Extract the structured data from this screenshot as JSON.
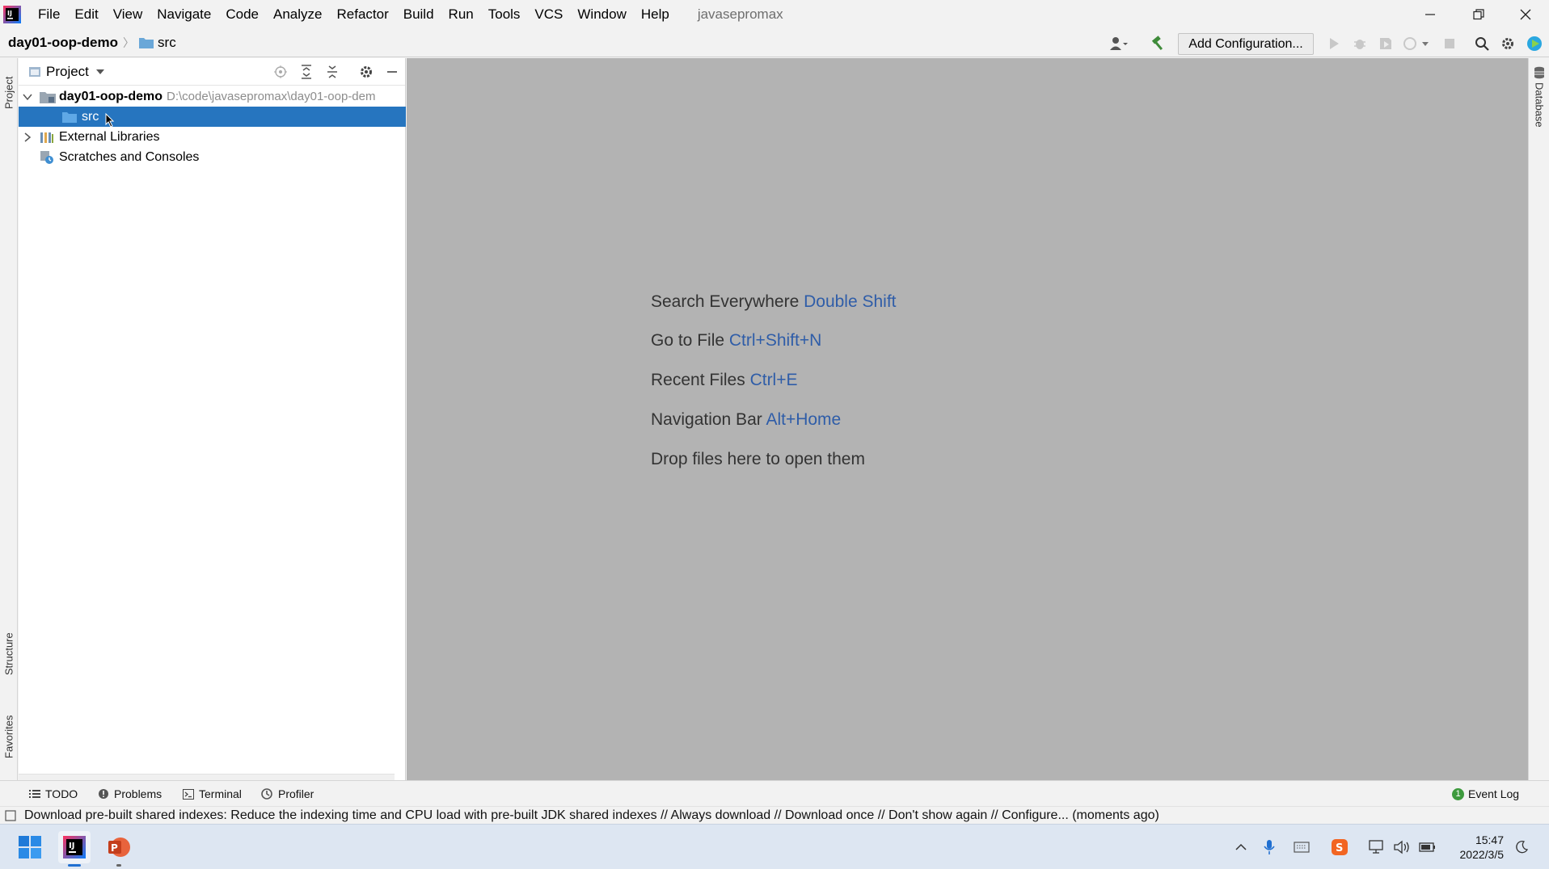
{
  "window": {
    "menu": [
      "File",
      "Edit",
      "View",
      "Navigate",
      "Code",
      "Analyze",
      "Refactor",
      "Build",
      "Run",
      "Tools",
      "VCS",
      "Window",
      "Help"
    ],
    "project_title": "javasepromax"
  },
  "navbar": {
    "crumb_root": "day01-oop-demo",
    "crumb_child": "src",
    "add_config_label": "Add Configuration..."
  },
  "side_tabs": {
    "project": "Project",
    "structure": "Structure",
    "favorites": "Favorites",
    "database": "Database"
  },
  "project_panel": {
    "title": "Project",
    "tree": [
      {
        "label": "day01-oop-demo",
        "path": "D:\\code\\javasepromax\\day01-oop-dem",
        "expanded": true
      },
      {
        "label": "src",
        "selected": true
      },
      {
        "label": "External Libraries",
        "expanded": false
      },
      {
        "label": "Scratches and Consoles"
      }
    ]
  },
  "editor_hints": [
    {
      "text": "Search Everywhere",
      "key": "Double Shift"
    },
    {
      "text": "Go to File",
      "key": "Ctrl+Shift+N"
    },
    {
      "text": "Recent Files",
      "key": "Ctrl+E"
    },
    {
      "text": "Navigation Bar",
      "key": "Alt+Home"
    },
    {
      "text": "Drop files here to open them",
      "key": ""
    }
  ],
  "bottom_tools": {
    "todo": "TODO",
    "problems": "Problems",
    "terminal": "Terminal",
    "profiler": "Profiler",
    "event_log": "Event Log",
    "event_count": "1"
  },
  "status": {
    "message": "Download pre-built shared indexes: Reduce the indexing time and CPU load with pre-built JDK shared indexes // Always download // Download once // Don't show again // Configure... (moments ago)"
  },
  "taskbar": {
    "time": "15:47",
    "date": "2022/3/5"
  },
  "colors": {
    "selection": "#2675bf",
    "editor_bg": "#b3b3b3",
    "hint_key": "#2f5da8"
  }
}
